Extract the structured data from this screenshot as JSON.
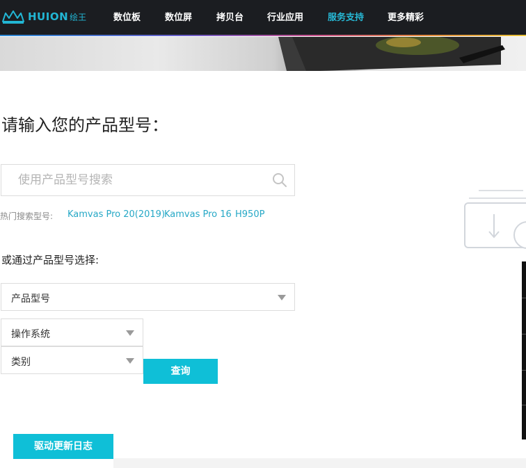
{
  "nav": {
    "logo_text": "HUION",
    "logo_cn": "绘王",
    "items": [
      {
        "label": "数位板",
        "active": false
      },
      {
        "label": "数位屏",
        "active": false
      },
      {
        "label": "拷贝台",
        "active": false
      },
      {
        "label": "行业应用",
        "active": false
      },
      {
        "label": "服务支持",
        "active": true
      },
      {
        "label": "更多精彩",
        "active": false
      }
    ],
    "accent_color": "#27b9d6"
  },
  "main": {
    "title": "请输入您的产品型号：",
    "search": {
      "placeholder": "使用产品型号搜索",
      "value": "",
      "icon": "search-icon"
    },
    "hot": {
      "label": "热门搜索型号:",
      "links": [
        "Kamvas Pro 20(2019)",
        "Kamvas Pro 16",
        "H950P"
      ]
    },
    "select_label": "或通过产品型号选择:",
    "selects": {
      "model": "产品型号",
      "os": "操作系统",
      "category": "类别"
    },
    "query_button": "查询",
    "changelog_button": "驱动更新日志"
  },
  "colors": {
    "button": "#0fbfd7",
    "link": "#26a8c6",
    "nav_bg": "#1b1d21"
  }
}
